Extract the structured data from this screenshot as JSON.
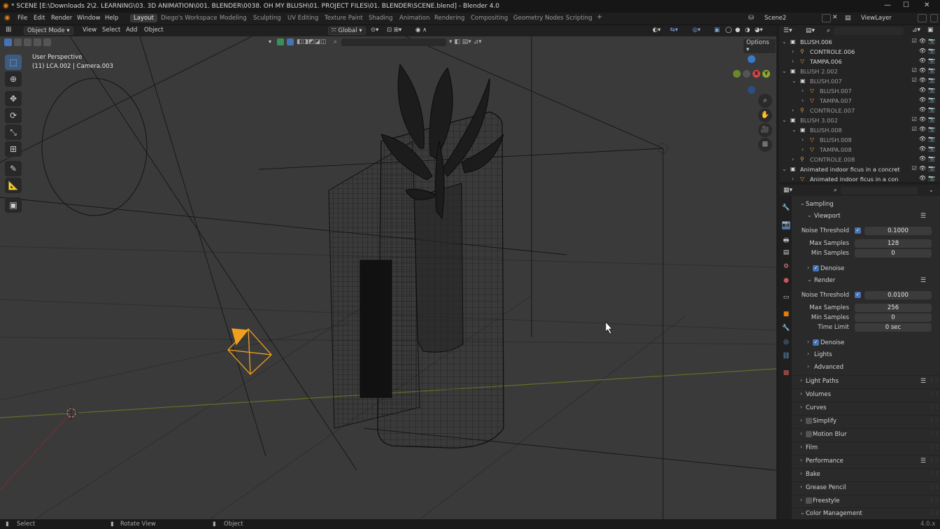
{
  "titlebar": {
    "title": "* SCENE [E:\\Downloads 2\\2. LEARNING\\03. 3D ANIMATION\\001. BLENDER\\0038. OH MY BLUSH\\01. PROJECT FILES\\01. BLENDER\\SCENE.blend] - Blender 4.0",
    "minimize": "—",
    "maximize": "☐",
    "close": "✕"
  },
  "menus": [
    "File",
    "Edit",
    "Render",
    "Window",
    "Help"
  ],
  "workspaces": [
    "Layout",
    "Diego's Workspace",
    "Modeling",
    "Sculpting",
    "UV Editing",
    "Texture Paint",
    "Shading",
    "Animation",
    "Rendering",
    "Compositing",
    "Geometry Nodes",
    "Scripting",
    "+"
  ],
  "scene_name": "Scene2",
  "view_layer": "ViewLayer",
  "viewport_header": {
    "mode": "Object Mode",
    "items": [
      "View",
      "Select",
      "Add",
      "Object"
    ],
    "orientation": "Global",
    "options": "Options"
  },
  "overlay_text": {
    "perspective": "User Perspective",
    "object_info": "(11) LCA.002 | Camera.003"
  },
  "outliner": {
    "rows": [
      {
        "label": "BLUSH.006",
        "type": "collection",
        "indent": 0
      },
      {
        "label": "CONTROLE.006",
        "type": "armature",
        "indent": 1
      },
      {
        "label": "TAMPA.006",
        "type": "mesh",
        "indent": 1
      },
      {
        "label": "BLUSH 2.002",
        "type": "collection",
        "indent": 0,
        "dim": true
      },
      {
        "label": "BLUSH.007",
        "type": "collection",
        "indent": 1,
        "dim": true
      },
      {
        "label": "BLUSH.007",
        "type": "mesh",
        "indent": 2,
        "dim": true
      },
      {
        "label": "TAMPA.007",
        "type": "mesh",
        "indent": 2,
        "dim": true
      },
      {
        "label": "CONTROLE.007",
        "type": "armature",
        "indent": 1,
        "dim": true
      },
      {
        "label": "BLUSH 3.002",
        "type": "collection",
        "indent": 0,
        "dim": true
      },
      {
        "label": "BLUSH.008",
        "type": "collection",
        "indent": 1,
        "dim": true
      },
      {
        "label": "BLUSH.008",
        "type": "mesh",
        "indent": 2,
        "dim": true
      },
      {
        "label": "TAMPA.008",
        "type": "mesh",
        "indent": 2,
        "dim": true
      },
      {
        "label": "CONTROLE.008",
        "type": "armature",
        "indent": 1,
        "dim": true
      },
      {
        "label": "Animated indoor ficus in a concret",
        "type": "collection",
        "indent": 0
      },
      {
        "label": "Animated indoor ficus in a con",
        "type": "object",
        "indent": 1
      }
    ]
  },
  "properties": {
    "sampling": "Sampling",
    "viewport": "Viewport",
    "render": "Render",
    "noise_threshold_label": "Noise Threshold",
    "max_samples_label": "Max Samples",
    "min_samples_label": "Min Samples",
    "time_limit_label": "Time Limit",
    "viewport_noise_threshold": "0.1000",
    "viewport_max_samples": "128",
    "viewport_min_samples": "0",
    "render_noise_threshold": "0.0100",
    "render_max_samples": "256",
    "render_min_samples": "0",
    "render_time_limit": "0 sec",
    "denoise": "Denoise",
    "lights": "Lights",
    "advanced": "Advanced",
    "sections": [
      "Light Paths",
      "Volumes",
      "Curves",
      "Simplify",
      "Motion Blur",
      "Film",
      "Performance",
      "Bake",
      "Grease Pencil",
      "Freestyle",
      "Color Management"
    ]
  },
  "statusbar": {
    "select": "Select",
    "rotate": "Rotate View",
    "object": "Object",
    "version": "4.0.x"
  },
  "colors": {
    "accent": "#4772b3",
    "camera": "#f0a020",
    "x_axis": "#c0393b",
    "y_axis": "#8aa82d",
    "z_axis": "#3b79c5"
  }
}
